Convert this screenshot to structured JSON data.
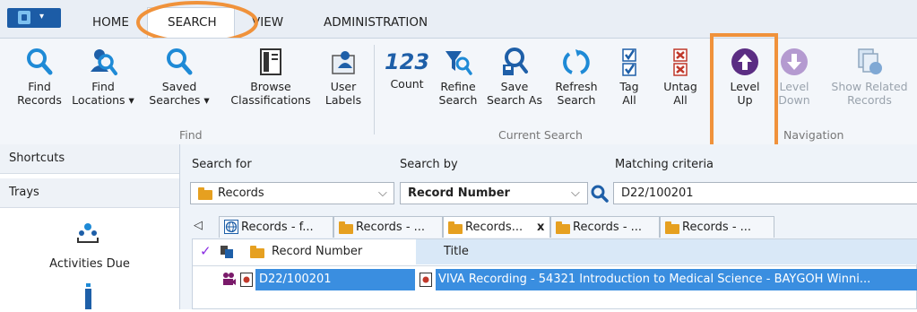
{
  "tabs": [
    "HOME",
    "SEARCH",
    "VIEW",
    "ADMINISTRATION"
  ],
  "ribbon": {
    "find_buttons": [
      {
        "label": "Find\nRecords",
        "icon": "search-icon"
      },
      {
        "label": "Find\nLocations ▾",
        "icon": "find-location-icon"
      },
      {
        "label": "Saved\nSearches ▾",
        "icon": "search-icon"
      },
      {
        "label": "Browse\nClassifications",
        "icon": "classification-icon"
      },
      {
        "label": "User\nLabels",
        "icon": "user-label-icon"
      }
    ],
    "current_buttons": [
      {
        "label": "Count",
        "icon": "count-icon"
      },
      {
        "label": "Refine\nSearch",
        "icon": "refine-search-icon"
      },
      {
        "label": "Save\nSearch As",
        "icon": "save-search-icon"
      },
      {
        "label": "Refresh\nSearch",
        "icon": "refresh-icon"
      },
      {
        "label": "Tag\nAll",
        "icon": "tag-all-icon"
      },
      {
        "label": "Untag\nAll",
        "icon": "untag-all-icon"
      }
    ],
    "nav_buttons": [
      {
        "label": "Level\nUp",
        "icon": "level-up-icon"
      },
      {
        "label": "Level\nDown",
        "icon": "level-down-icon"
      },
      {
        "label": "Show Related\nRecords",
        "icon": "related-records-icon"
      }
    ],
    "count_glyph": "123",
    "groups": {
      "find": "Find",
      "current": "Current Search",
      "navigation": "Navigation"
    }
  },
  "left_panel": {
    "shortcuts": "Shortcuts",
    "trays": "Trays",
    "activities": "Activities Due"
  },
  "search": {
    "search_for_label": "Search for",
    "search_by_label": "Search by",
    "matching_label": "Matching criteria",
    "search_for_value": "Records",
    "search_by_value": "Record Number",
    "criteria_value": "D22/100201"
  },
  "doc_tabs": [
    "Records - f...",
    "Records - ...",
    "Records...",
    "Records - ...",
    "Records - ..."
  ],
  "doc_tab_close": "x",
  "grid": {
    "columns": [
      "Record Number",
      "Title"
    ],
    "rows": [
      {
        "record_number": "D22/100201",
        "title": "VIVA Recording - 54321 Introduction to Medical Science - BAYGOH Winni..."
      }
    ]
  }
}
